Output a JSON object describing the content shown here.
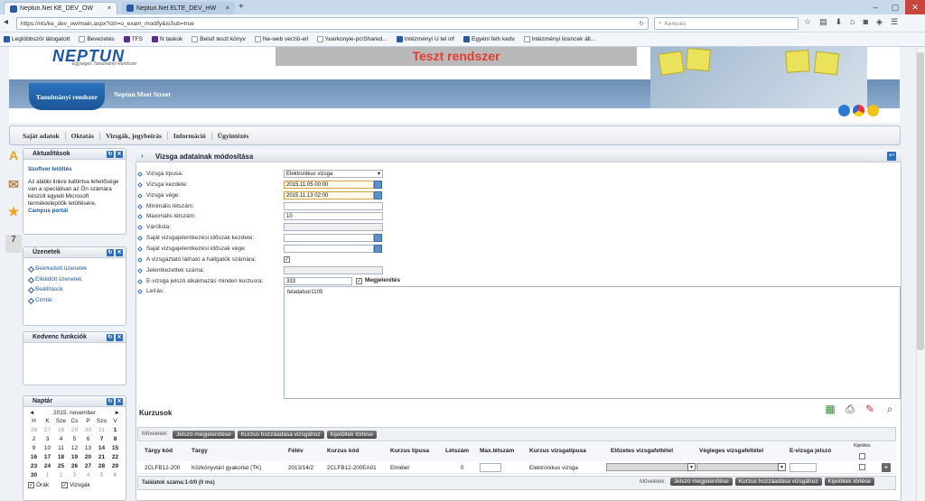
{
  "browser": {
    "tabs": [
      {
        "title": "Neptun.Net KE_DEV_OW",
        "close": "×"
      },
      {
        "title": "Neptun.Net ELTE_DEV_HW",
        "close": "×"
      }
    ],
    "new_tab": "+",
    "url": "https://nts/ke_dev_ow/main.aspx?ctrl=o_exam_modify&isSub=true",
    "search_placeholder": "Keresés",
    "bookmarks": [
      "Legtöbbször látogatott",
      "Bevezetés",
      "TFS",
      "N taskok",
      "Belső teszt könyv",
      "Ne-web verzió-eil",
      "\\\\varkonyie-pc\\Shared...",
      "Intézményi U tel inf",
      "Egyéni felh kedv",
      "Intézményi licencek áll..."
    ]
  },
  "header": {
    "logo": "NEPTUN",
    "logo_sub": "Egységes Tanulmányi Rendszer",
    "test_banner": "Teszt rendszer",
    "system_badge": "Tanulmányi rendszer",
    "meet_street": "Neptun Meet Street"
  },
  "menu": [
    "Saját adatok",
    "Oktatás",
    "Vizsgák, jegybeírás",
    "Információ",
    "Ügyintézés"
  ],
  "side_icons": [
    "A",
    "7"
  ],
  "panels": {
    "aktualitasok": {
      "title": "Aktualitások",
      "link": "Szoftver letöltés",
      "text": "Az alábbi linkre kattintva lehetősége van a speciálisan az Ön számára készült egyedi Microsoft terméktelepítők letöltésére.",
      "portal": "Campus portál"
    },
    "uzenetek": {
      "title": "Üzenetek",
      "items": [
        "Beérkezett üzenetek",
        "Elküldött üzenetek",
        "Beállítások",
        "Címtár"
      ]
    },
    "kedvenc": {
      "title": "Kedvenc funkciók"
    },
    "naptar": {
      "title": "Naptár",
      "month": "2015. november",
      "prev": "◄",
      "next": "►",
      "days": [
        "H",
        "K",
        "Sze",
        "Cs",
        "P",
        "Szo",
        "V"
      ],
      "weeks": [
        [
          "26",
          "27",
          "28",
          "29",
          "30",
          "31",
          "1"
        ],
        [
          "2",
          "3",
          "4",
          "5",
          "6",
          "7",
          "8"
        ],
        [
          "9",
          "10",
          "11",
          "12",
          "13",
          "14",
          "15"
        ],
        [
          "16",
          "17",
          "18",
          "19",
          "20",
          "21",
          "22"
        ],
        [
          "23",
          "24",
          "25",
          "26",
          "27",
          "28",
          "29"
        ],
        [
          "30",
          "1",
          "2",
          "3",
          "4",
          "5",
          "6"
        ]
      ],
      "opt_orak": "Órák",
      "opt_vizsgak": "Vizsgák"
    }
  },
  "main": {
    "title": "Vizsga adatainak módosítása",
    "fields": {
      "tipus_label": "Vizsga típusa:",
      "tipus_value": "Elektronikus vizsga",
      "kezdete_label": "Vizsga kezdete:",
      "kezdete_value": "2015.11.05 00:00",
      "vege_label": "Vizsga vége:",
      "vege_value": "2015.11.13 02:00",
      "min_label": "Minimális létszám:",
      "max_label": "Maximális létszám:",
      "max_value": "10",
      "varolista_label": "Várólista:",
      "sajat_kezd_label": "Saját vizsgajelentkezési időszak kezdete:",
      "sajat_vege_label": "Saját vizsgajelentkezési időszak vége:",
      "lathato_label": "A vizsgáztató látható a hallgatók számára:",
      "jelentkezettek_label": "Jelentkezettek száma:",
      "jelszo_label": "E-vizsga jelszó alkalmazás minden kurzusra:",
      "jelszo_value": "333",
      "megjelenites": "Megjelenítés",
      "leiras_label": "Leírás:",
      "leiras_value": "feladatsor1105"
    },
    "kurzusok": {
      "title": "Kurzusok",
      "muveletek": "Műveletek:",
      "buttons": [
        "Jelszó megjelenítése",
        "Kurzus hozzáadása vizsgához",
        "Kijelöltek törlése"
      ],
      "columns": [
        "Tárgy kód",
        "Tárgy",
        "Félév",
        "Kurzus kód",
        "Kurzus típusa",
        "Létszám",
        "Max.létszám",
        "Kurzus vizsgatípusa",
        "Előzetes vizsgafeltétel",
        "Végleges vizsgafeltétel",
        "E-vizsga jelszó",
        "Kijelölés"
      ],
      "rows": [
        {
          "targy_kod": "2CLFB12-200",
          "targy": "Közkönyvtári gyakorlat (TK)",
          "felev": "2013/14/2",
          "kurzus_kod": "2CLFB12-200EA01",
          "kurzus_tipus": "Elmélet",
          "letszam": "0",
          "vizsgatipus": "Elektronikus vizsga"
        }
      ],
      "talalatok": "Találatok száma:1-0/0 (0 ms)"
    }
  },
  "colors": {
    "accent": "#1d58a8",
    "test_red": "#e53b2e",
    "header_band": "#7a9cc2"
  }
}
